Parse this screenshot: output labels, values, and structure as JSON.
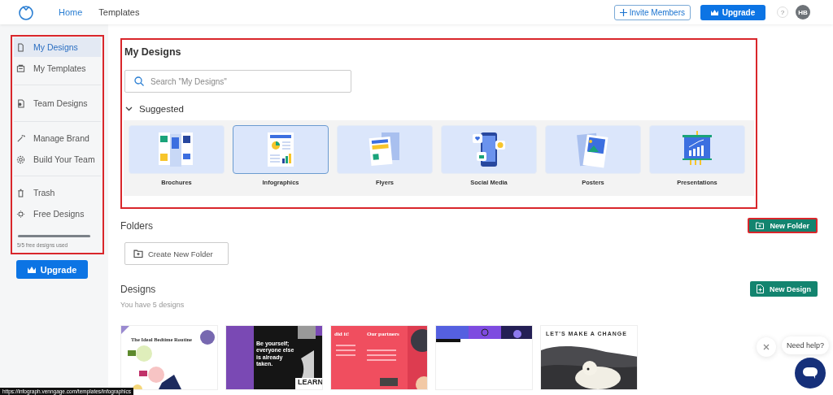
{
  "topbar": {
    "nav": [
      {
        "label": "Home",
        "selected": true
      },
      {
        "label": "Templates",
        "selected": false
      }
    ],
    "invite_button": "Invite Members",
    "upgrade_button": "Upgrade",
    "help": "?",
    "avatar": "HB"
  },
  "sidebar": {
    "groups": [
      {
        "items": [
          {
            "label": "My Designs",
            "selected": true
          },
          {
            "label": "My Templates",
            "selected": false
          }
        ]
      },
      {
        "items": [
          {
            "label": "Team Designs",
            "selected": false
          }
        ]
      },
      {
        "items": [
          {
            "label": "Manage Brand",
            "selected": false
          },
          {
            "label": "Build Your Team",
            "selected": false
          }
        ]
      },
      {
        "items": [
          {
            "label": "Trash",
            "selected": false
          },
          {
            "label": "Free Designs",
            "selected": false
          }
        ]
      }
    ],
    "usage": {
      "level": 1,
      "text": "5/5 free designs used"
    },
    "upgrade_button": "Upgrade"
  },
  "my_designs": {
    "title": "My Designs",
    "search": {
      "placeholder": "Search \"My Designs\""
    },
    "suggested": {
      "label": "Suggested",
      "expanded": true,
      "tiles": [
        {
          "kind": "brochure",
          "label": "Brochures",
          "selected": false
        },
        {
          "kind": "infographic",
          "label": "Infographics",
          "selected": true
        },
        {
          "kind": "flyer",
          "label": "Flyers",
          "selected": false
        },
        {
          "kind": "social",
          "label": "Social Media",
          "selected": false
        },
        {
          "kind": "poster",
          "label": "Posters",
          "selected": false
        },
        {
          "kind": "presentation",
          "label": "Presentations",
          "selected": false
        }
      ]
    }
  },
  "folders": {
    "title": "Folders",
    "new_button": "New Folder",
    "create_button": "Create New Folder"
  },
  "designs": {
    "title": "Designs",
    "count": "You have 5 designs",
    "new_button": "New Design",
    "cards": [
      {
        "kind": "picture",
        "texts": [
          "The Ideal Bedtime Routine"
        ]
      },
      {
        "kind": "picture",
        "texts": [
          "Be yourself; everyone else is already taken.",
          "LEARN"
        ]
      },
      {
        "kind": "picture",
        "texts": [
          "did it!",
          "Our partners"
        ]
      },
      {
        "kind": "picture"
      },
      {
        "kind": "picture",
        "texts": [
          "LET'S MAKE A CHANGE"
        ]
      }
    ]
  },
  "chat": {
    "bubble": "Need help?"
  },
  "status_url": "https://infograph.venngage.com/templates/infographics"
}
